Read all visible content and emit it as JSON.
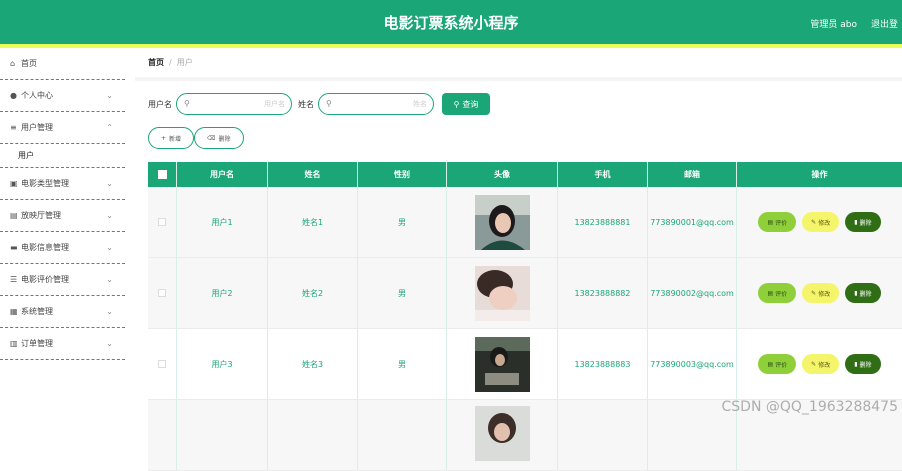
{
  "header": {
    "title": "电影订票系统小程序",
    "user": "管理员 abo",
    "logout": "退出登"
  },
  "sidebar": {
    "items": [
      {
        "label": "首页",
        "icon": "home-icon",
        "has_arrow": false
      },
      {
        "label": "个人中心",
        "icon": "user-icon",
        "has_arrow": true
      },
      {
        "label": "用户管理",
        "icon": "list-icon",
        "has_arrow": true,
        "expanded": true
      },
      {
        "label": "电影类型管理",
        "icon": "briefcase-icon",
        "has_arrow": true
      },
      {
        "label": "放映厅管理",
        "icon": "document-icon",
        "has_arrow": true
      },
      {
        "label": "电影信息管理",
        "icon": "monitor-icon",
        "has_arrow": true
      },
      {
        "label": "电影评价管理",
        "icon": "sliders-icon",
        "has_arrow": true
      },
      {
        "label": "系统管理",
        "icon": "grid-icon",
        "has_arrow": true
      },
      {
        "label": "订单管理",
        "icon": "clipboard-icon",
        "has_arrow": true
      }
    ],
    "subitem": "用户"
  },
  "breadcrumb": {
    "home": "首页",
    "separator": "/",
    "current": "用户"
  },
  "search": {
    "username_label": "用户名",
    "username_placeholder": "用户名",
    "name_label": "姓名",
    "name_placeholder": "姓名",
    "query_button": "查询"
  },
  "actions": {
    "add": "新增",
    "delete": "删除"
  },
  "table": {
    "columns": [
      "用户名",
      "姓名",
      "性别",
      "头像",
      "手机",
      "邮箱",
      "操作"
    ],
    "rows": [
      {
        "username": "用户1",
        "name": "姓名1",
        "gender": "男",
        "phone": "13823888881",
        "email": "773890001@qq.com"
      },
      {
        "username": "用户2",
        "name": "姓名2",
        "gender": "男",
        "phone": "13823888882",
        "email": "773890002@qq.com"
      },
      {
        "username": "用户3",
        "name": "姓名3",
        "gender": "男",
        "phone": "13823888883",
        "email": "773890003@qq.com"
      }
    ],
    "row_actions": {
      "evaluate": "评价",
      "edit": "修改",
      "delete": "删除"
    }
  },
  "watermark": "CSDN @QQ_1963288475",
  "colors": {
    "primary": "#1aa676",
    "accent_line": "#e8ff5a",
    "evaluate": "#8fd03a",
    "edit": "#f4f56a",
    "delete": "#2f6e14"
  }
}
